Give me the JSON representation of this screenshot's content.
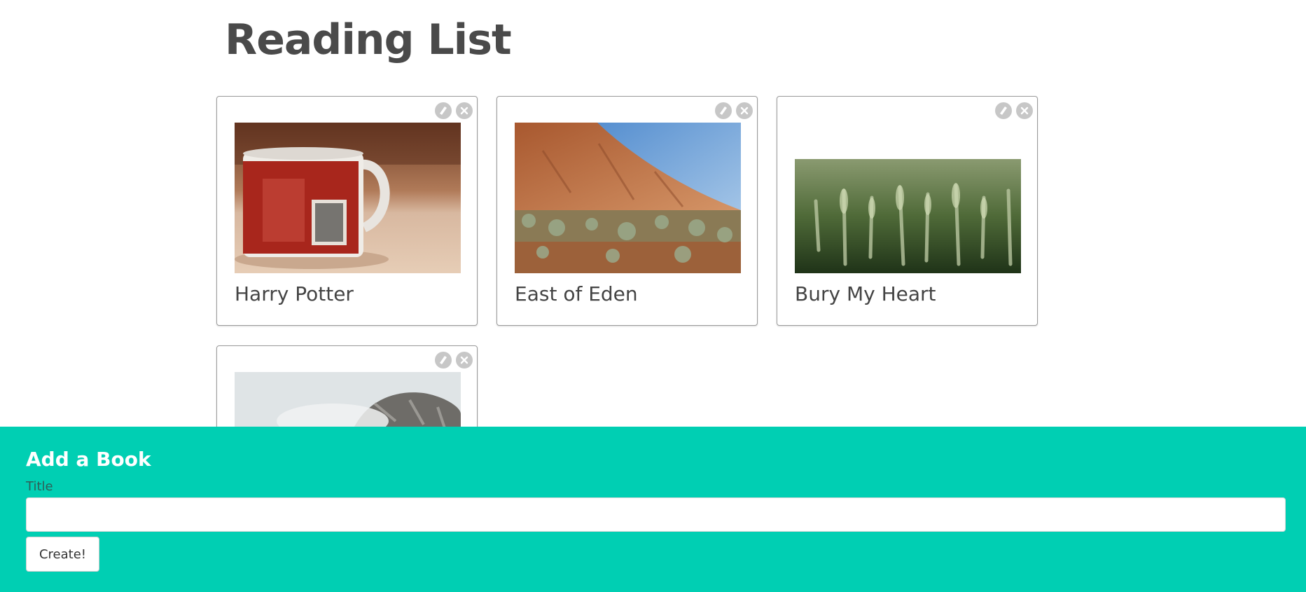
{
  "header": {
    "title": "Reading List"
  },
  "books": [
    {
      "title": "Harry Potter",
      "image": "mug-photo"
    },
    {
      "title": "East of Eden",
      "image": "desert-rock-photo"
    },
    {
      "title": "Bury My Heart",
      "image": "wheat-field-photo"
    },
    {
      "title": "",
      "image": "mountain-photo"
    }
  ],
  "card_actions": {
    "edit_icon": "pencil-icon",
    "delete_icon": "close-icon"
  },
  "add_form": {
    "heading": "Add a Book",
    "title_label": "Title",
    "title_value": "",
    "title_placeholder": "",
    "submit_label": "Create!"
  },
  "colors": {
    "panel": "#00cfb3",
    "icon_bg": "#c7c7c7",
    "text": "#444444"
  }
}
